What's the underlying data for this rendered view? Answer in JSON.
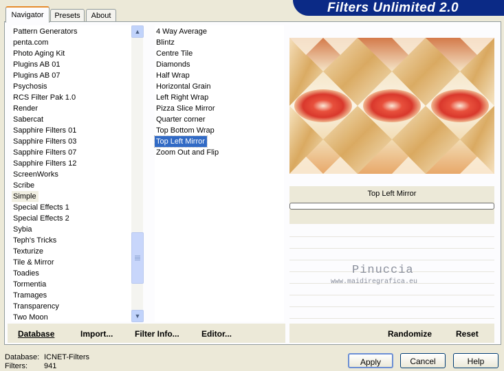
{
  "tabs": [
    {
      "label": "Navigator",
      "active": true
    },
    {
      "label": "Presets",
      "active": false
    },
    {
      "label": "About",
      "active": false
    }
  ],
  "app_title": "Filters Unlimited 2.0",
  "categories": [
    "Pattern Generators",
    "penta.com",
    "Photo Aging Kit",
    "Plugins AB 01",
    "Plugins AB 07",
    "Psychosis",
    "RCS Filter Pak 1.0",
    "Render",
    "Sabercat",
    "Sapphire Filters 01",
    "Sapphire Filters 03",
    "Sapphire Filters 07",
    "Sapphire Filters 12",
    "ScreenWorks",
    "Scribe",
    "Simple",
    "Special Effects 1",
    "Special Effects 2",
    "Sybia",
    "Teph's Tricks",
    "Texturize",
    "Tile & Mirror",
    "Toadies",
    "Tormentia",
    "Tramages",
    "Transparency",
    "Two Moon"
  ],
  "selected_category": "Simple",
  "filters": [
    "4 Way Average",
    "Blintz",
    "Centre Tile",
    "Diamonds",
    "Half Wrap",
    "Horizontal Grain",
    "Left Right Wrap",
    "Pizza Slice Mirror",
    "Quarter corner",
    "Top Bottom Wrap",
    "Top Left Mirror",
    "Zoom Out and Flip"
  ],
  "selected_filter": "Top Left Mirror",
  "preview_caption": "Top Left Mirror",
  "watermark": {
    "line1": "Pinuccia",
    "line2": "www.maidiregrafica.eu"
  },
  "toolbar_left": {
    "database": "Database",
    "import": "Import...",
    "filter_info": "Filter Info...",
    "editor": "Editor..."
  },
  "toolbar_right": {
    "randomize": "Randomize",
    "reset": "Reset"
  },
  "status": {
    "database_label": "Database:",
    "database_value": "ICNET-Filters",
    "filters_label": "Filters:",
    "filters_value": "941"
  },
  "buttons": {
    "apply": "Apply",
    "cancel": "Cancel",
    "help": "Help"
  },
  "colors": {
    "accent": "#316ac5",
    "banner": "#0b2a86",
    "tab_highlight": "#e68b2c"
  }
}
